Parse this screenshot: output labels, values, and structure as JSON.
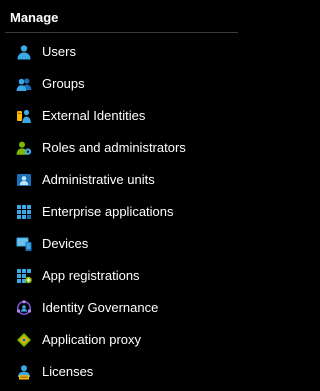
{
  "section": {
    "title": "Manage"
  },
  "nav_items": [
    {
      "label": "Users",
      "icon": "user-icon"
    },
    {
      "label": "Groups",
      "icon": "groups-icon"
    },
    {
      "label": "External Identities",
      "icon": "external-identities-icon"
    },
    {
      "label": "Roles and administrators",
      "icon": "roles-icon"
    },
    {
      "label": "Administrative units",
      "icon": "administrative-units-icon"
    },
    {
      "label": "Enterprise applications",
      "icon": "enterprise-apps-icon"
    },
    {
      "label": "Devices",
      "icon": "devices-icon"
    },
    {
      "label": "App registrations",
      "icon": "app-registrations-icon"
    },
    {
      "label": "Identity Governance",
      "icon": "identity-governance-icon"
    },
    {
      "label": "Application proxy",
      "icon": "application-proxy-icon"
    },
    {
      "label": "Licenses",
      "icon": "licenses-icon"
    }
  ],
  "colors": {
    "background": "#000000",
    "text": "#ffffff",
    "divider": "#3b3b3b",
    "icon_blue": "#3ba7e5",
    "icon_dark_blue": "#1b6fb8",
    "icon_green": "#7fba00",
    "icon_yellow": "#ffb900"
  }
}
